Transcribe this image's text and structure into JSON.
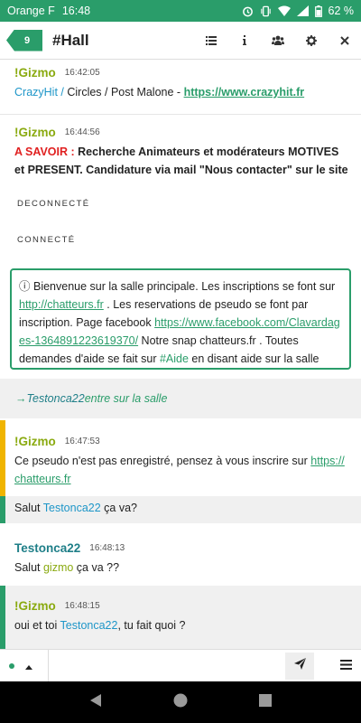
{
  "status_bar": {
    "carrier": "Orange F",
    "time": "16:48",
    "battery": "62 %"
  },
  "header": {
    "badge_count": "9",
    "room_title": "#Hall",
    "icons": [
      "list-icon",
      "info-icon",
      "users-icon",
      "gear-icon",
      "close-icon"
    ]
  },
  "messages": [
    {
      "nick": "!Gizmo",
      "time": "16:42:05",
      "brand": "CrazyHit",
      "slash1": " /",
      "track": " Circles / Post Malone - ",
      "url": "https://www.crazyhit.fr"
    },
    {
      "nick": "!Gizmo",
      "time": "16:44:56",
      "label": "A SAVOIR :",
      "body": "  Recherche Animateurs et modérateurs MOTIVES et PRESENT. Candidature via mail \"Nous contacter\" sur le site"
    }
  ],
  "system": {
    "disconnected": "DECONNECTÉ",
    "connected": "CONNECTÉ"
  },
  "welcome": {
    "icon": "ⓘ",
    "part1": " Bienvenue sur la salle principale. Les inscriptions se font sur ",
    "url1": "http://chatteurs.fr",
    "part2": " . Les reservations de pseudo se font par inscription. Page facebook ",
    "url2": "https://www.facebook.com/Clavardages-1364891223619370/",
    "part3": " Notre snap chatteurs.fr . Toutes demandes d'aide se fait sur ",
    "tag": "#Aide",
    "part4": " en disant aide sur la salle"
  },
  "entry": {
    "arrow": "→ ",
    "who": "Testonca22",
    "text": " entre sur la salle"
  },
  "chat": {
    "m3_nick": "!Gizmo",
    "m3_time": "16:47:53",
    "m3_text": "Ce pseudo n'est pas enregistré, pensez à vous inscrire sur ",
    "m3_url": "https://chatteurs.fr",
    "m4_pre": "Salut ",
    "m4_mention": "Testonca22",
    "m4_post": " ça va?",
    "m5_nick": "Testonca22",
    "m5_time": "16:48:13",
    "m5_pre": "Salut ",
    "m5_mention": "gizmo",
    "m5_post": " ça va ??",
    "m6_nick": "!Gizmo",
    "m6_time": "16:48:15",
    "m6_pre": "oui et toi ",
    "m6_mention": "Testonca22",
    "m6_post": ", tu fait quoi ?"
  },
  "composer": {
    "placeholder": "",
    "send_icon": "send-icon",
    "menu_icon": "hamburger-icon"
  },
  "colors": {
    "accent": "#2a9d6a",
    "gizmo_nick": "#8aaa10",
    "mention": "#1e96c8",
    "highlight_bar": "#f0b400"
  }
}
